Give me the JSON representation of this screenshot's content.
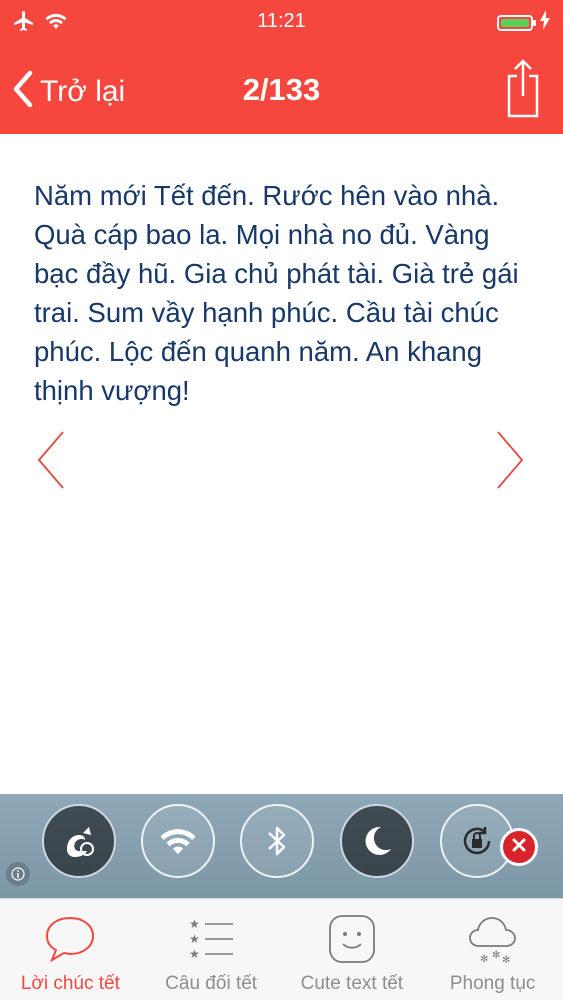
{
  "status_bar": {
    "time": "11:21",
    "icons": [
      "airplane-icon",
      "wifi-icon",
      "battery-icon",
      "charging-icon"
    ]
  },
  "nav": {
    "back_label": "Trở lại",
    "page_counter": "2/133",
    "share_icon": "share-icon"
  },
  "content": {
    "message": "Năm mới Tết đến. Rước hên vào nhà. Quà cáp bao la. Mọi nhà no đủ. Vàng bạc đầy hũ. Gia chủ phát tài. Già trẻ gái trai. Sum vầy hạnh phúc. Cầu tài chúc phúc. Lộc đến quanh năm. An khang thịnh vượng!"
  },
  "ad": {
    "icons": [
      "uc-browser-icon",
      "wifi-icon",
      "bluetooth-icon",
      "moon-icon",
      "rotation-lock-icon"
    ]
  },
  "tabs": [
    {
      "label": "Lời chúc tết",
      "icon": "speech-bubble-icon",
      "active": true
    },
    {
      "label": "Câu đối tết",
      "icon": "star-list-icon",
      "active": false
    },
    {
      "label": "Cute text tết",
      "icon": "smiley-face-icon",
      "active": false
    },
    {
      "label": "Phong tục",
      "icon": "snow-cloud-icon",
      "active": false
    }
  ],
  "colors": {
    "accent": "#f6473f",
    "text": "#173868",
    "tab_inactive": "#8e8e8e"
  }
}
